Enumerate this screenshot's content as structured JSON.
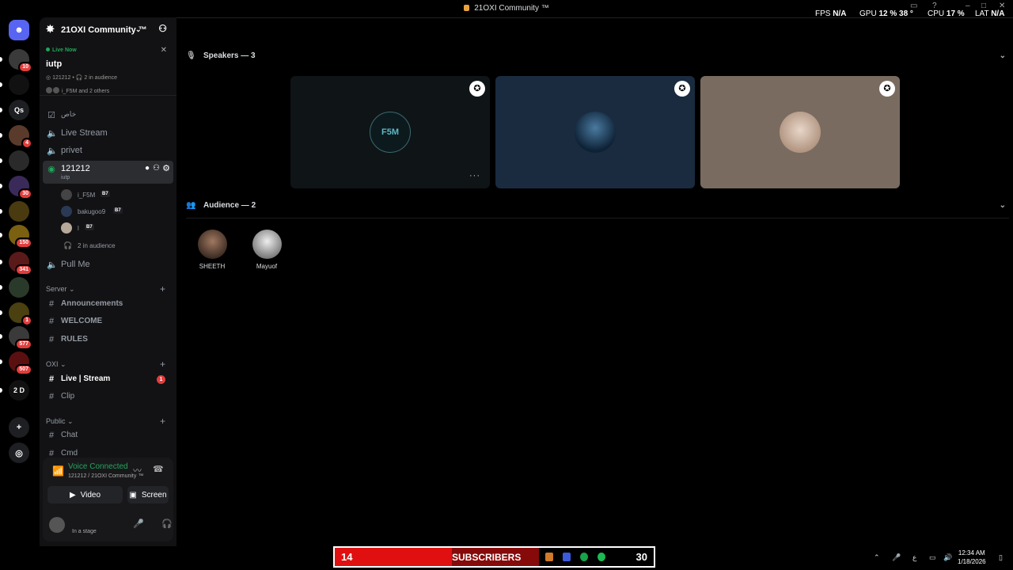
{
  "window": {
    "title": "21OXI Community ™"
  },
  "overlay": {
    "fps_label": "FPS",
    "fps_value": "N/A",
    "gpu_label": "GPU",
    "gpu_value": "12 %",
    "gpu_temp": "38 °",
    "cpu_label": "CPU",
    "cpu_value": "17 %",
    "lat_label": "LAT",
    "lat_value": "N/A"
  },
  "guilds": [
    {
      "label": "",
      "badge": "10"
    },
    {
      "label": "",
      "badge": ""
    },
    {
      "label": "Qs",
      "badge": ""
    },
    {
      "label": "",
      "badge": "4"
    },
    {
      "label": "",
      "badge": ""
    },
    {
      "label": "",
      "badge": "30"
    },
    {
      "label": "",
      "badge": ""
    },
    {
      "label": "",
      "badge": "150"
    },
    {
      "label": "",
      "badge": "341"
    },
    {
      "label": "",
      "badge": ""
    },
    {
      "label": "",
      "badge": "1"
    },
    {
      "label": "",
      "badge": "577"
    },
    {
      "label": "",
      "badge": "507"
    },
    {
      "label": "2 D",
      "badge": ""
    }
  ],
  "server": {
    "name": "21OXI Community ™"
  },
  "live_now": {
    "label": "Live Now",
    "title": "iutp",
    "meta": "121212 • 🎧 2 in audience",
    "users": "i_F5M and 2 others"
  },
  "channels": {
    "c0": "خاص",
    "c1": "Live Stream",
    "c2": "privet",
    "c3": "121212",
    "c3_sub": "iutp",
    "users": [
      {
        "name": "i_F5M",
        "tag": "B7"
      },
      {
        "name": "bakugoo9",
        "tag": "B7"
      },
      {
        "name": "l",
        "tag": "B7"
      }
    ],
    "audience": "2 in audience",
    "c4": "Pull Me",
    "cat_server": "Server",
    "announcements": "Announcements",
    "welcome": "WELCOME",
    "rules": "RULES",
    "cat_oxi": "OXI",
    "live_stream": "Live | Stream",
    "live_stream_badge": "1",
    "clip": "Clip",
    "cat_public": "Public",
    "chat": "Chat",
    "cmd": "Cmd"
  },
  "voice": {
    "status": "Voice Connected",
    "location": "121212 / 21OXI Community ™",
    "video": "Video",
    "screen": "Screen"
  },
  "account": {
    "status": "In a stage"
  },
  "stage": {
    "speakers_label": "Speakers — 3",
    "audience_label": "Audience — 2",
    "speakers": [
      {
        "avatar_text": "F5M",
        "bg": "#0f1417"
      },
      {
        "avatar_text": "",
        "bg": "#1a2b3f"
      },
      {
        "avatar_text": "",
        "bg": "#7a6b60"
      }
    ],
    "audience": [
      {
        "name": "SHEETH"
      },
      {
        "name": "Mayuof"
      }
    ]
  },
  "taskbar": {
    "sub_left": "14",
    "sub_mid": "SUBSCRIBERS",
    "sub_right": "30",
    "time": "12:34 AM",
    "date": "1/18/2026",
    "lang": "ع"
  },
  "colors": {
    "accent_green": "#23a55a",
    "badge_red": "#e23d3d",
    "sub_red": "#e01010"
  }
}
